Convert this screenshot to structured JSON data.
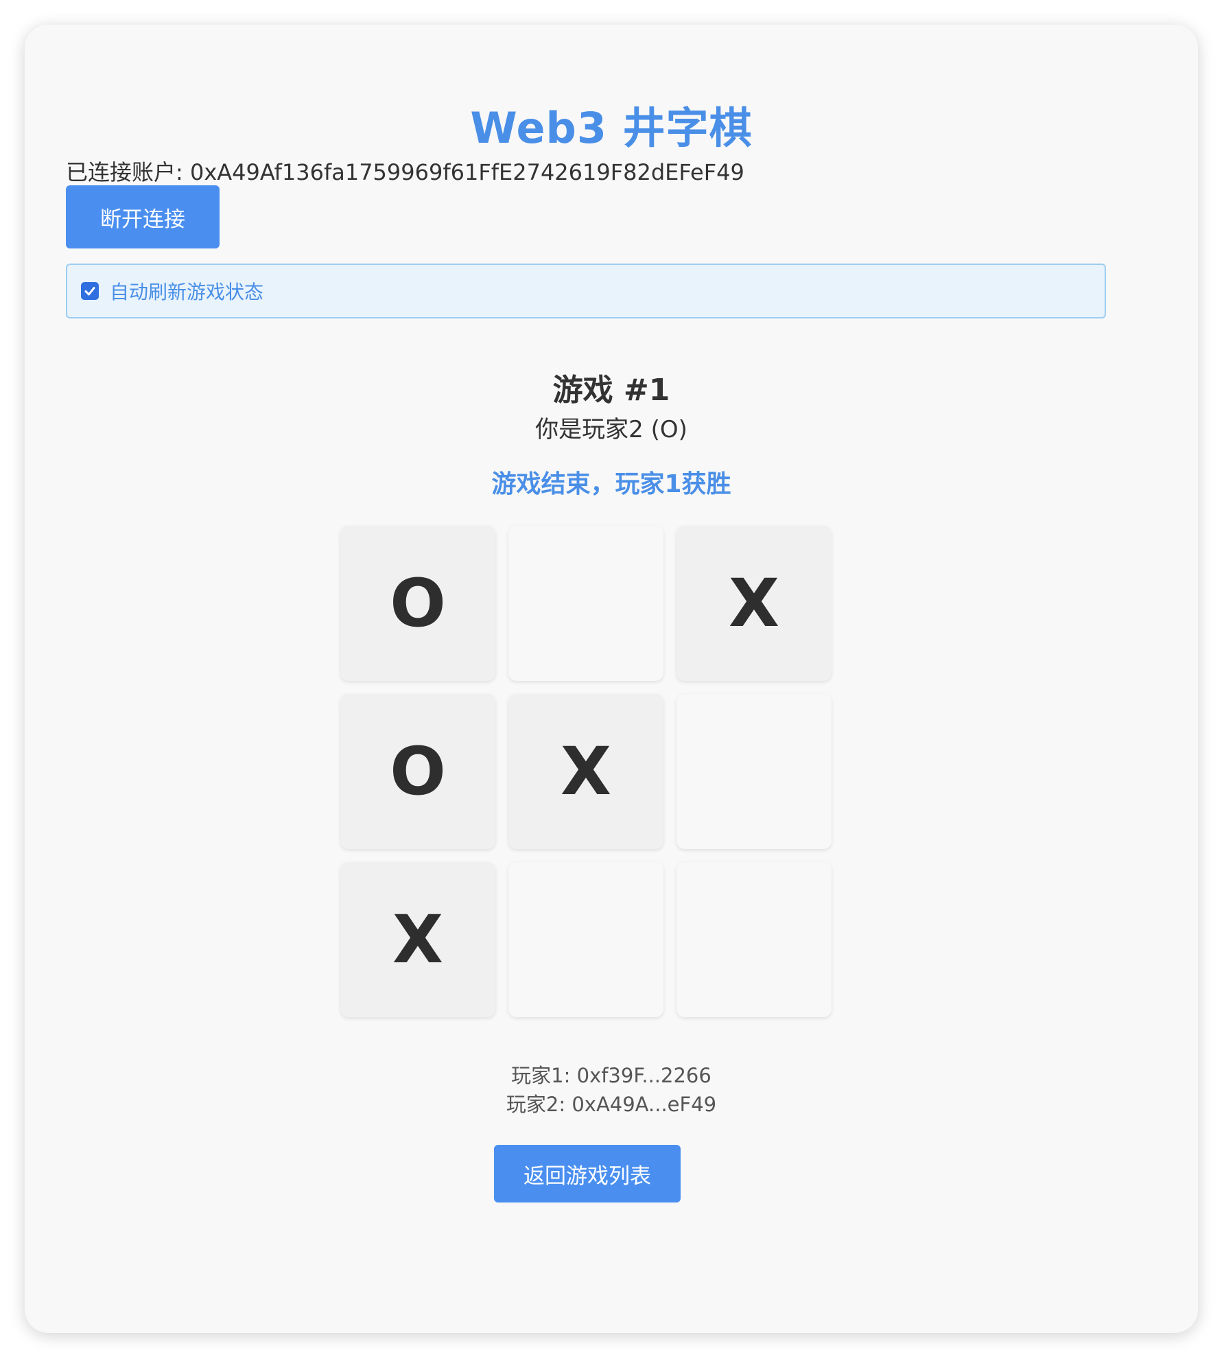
{
  "app": {
    "title": "Web3 井字棋"
  },
  "account": {
    "text": "已连接账户: 0xA49Af136fa1759969f61FfE2742619F82dEFeF49"
  },
  "buttons": {
    "disconnect_label": "断开连接",
    "back_label": "返回游戏列表"
  },
  "auto_refresh": {
    "label": "自动刷新游戏状态",
    "checked": true
  },
  "game": {
    "title": "游戏 #1",
    "you_are": "你是玩家2 (O)",
    "status": "游戏结束，玩家1获胜",
    "board": [
      "O",
      "",
      "X",
      "O",
      "X",
      "",
      "X",
      "",
      ""
    ]
  },
  "players": {
    "player1": "玩家1: 0xf39F...2266",
    "player2": "玩家2: 0xA49A...eF49"
  },
  "colors": {
    "accent": "#4a8fe7",
    "button": "#4a8ff0",
    "info_bg": "#e8f3fc",
    "info_border": "#9ccdf0"
  }
}
